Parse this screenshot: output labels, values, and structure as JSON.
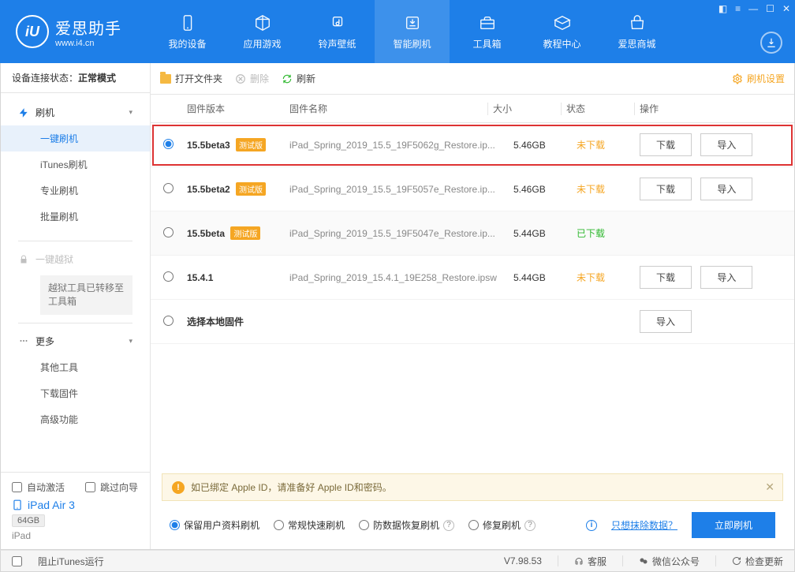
{
  "titlebar": {
    "controls": [
      "◧",
      "≡",
      "—",
      "☐",
      "✕"
    ]
  },
  "logo": {
    "name": "爱思助手",
    "url": "www.i4.cn",
    "mark": "iU"
  },
  "nav": [
    {
      "label": "我的设备",
      "icon": "device"
    },
    {
      "label": "应用游戏",
      "icon": "apps"
    },
    {
      "label": "铃声壁纸",
      "icon": "ringtone"
    },
    {
      "label": "智能刷机",
      "icon": "flash",
      "active": true
    },
    {
      "label": "工具箱",
      "icon": "toolbox"
    },
    {
      "label": "教程中心",
      "icon": "tutorial"
    },
    {
      "label": "爱思商城",
      "icon": "shop"
    }
  ],
  "sidebar": {
    "conn_label": "设备连接状态：",
    "conn_value": "正常模式",
    "flash": {
      "head": "刷机",
      "items": [
        "一键刷机",
        "iTunes刷机",
        "专业刷机",
        "批量刷机"
      ]
    },
    "jailbreak": {
      "head": "一键越狱",
      "note": "越狱工具已转移至工具箱"
    },
    "more": {
      "head": "更多",
      "items": [
        "其他工具",
        "下载固件",
        "高级功能"
      ]
    },
    "auto_activate": "自动激活",
    "skip_guide": "跳过向导",
    "device_name": "iPad Air 3",
    "storage": "64GB",
    "device_type": "iPad"
  },
  "toolbar": {
    "open_folder": "打开文件夹",
    "delete": "删除",
    "refresh": "刷新",
    "settings": "刷机设置"
  },
  "table": {
    "headers": {
      "version": "固件版本",
      "name": "固件名称",
      "size": "大小",
      "status": "状态",
      "action": "操作"
    },
    "download_btn": "下载",
    "import_btn": "导入",
    "local_firmware": "选择本地固件",
    "rows": [
      {
        "version": "15.5beta3",
        "beta": "测试版",
        "name": "iPad_Spring_2019_15.5_19F5062g_Restore.ip...",
        "size": "5.46GB",
        "status": "未下载",
        "status_cls": "un",
        "dl": true,
        "imp": true,
        "highlight": true,
        "selected": true
      },
      {
        "version": "15.5beta2",
        "beta": "测试版",
        "name": "iPad_Spring_2019_15.5_19F5057e_Restore.ip...",
        "size": "5.46GB",
        "status": "未下载",
        "status_cls": "un",
        "dl": true,
        "imp": true
      },
      {
        "version": "15.5beta",
        "beta": "测试版",
        "name": "iPad_Spring_2019_15.5_19F5047e_Restore.ip...",
        "size": "5.44GB",
        "status": "已下载",
        "status_cls": "done",
        "alt": true
      },
      {
        "version": "15.4.1",
        "name": "iPad_Spring_2019_15.4.1_19E258_Restore.ipsw",
        "size": "5.44GB",
        "status": "未下载",
        "status_cls": "un",
        "dl": true,
        "imp": true
      }
    ]
  },
  "tip": "如已绑定 Apple ID，请准备好 Apple ID和密码。",
  "modes": {
    "keep_data": "保留用户资料刷机",
    "normal": "常规快速刷机",
    "anti_loss": "防数据恢复刷机",
    "repair": "修复刷机",
    "erase_link": "只想抹除数据？",
    "flash_now": "立即刷机"
  },
  "statusbar": {
    "block_itunes": "阻止iTunes运行",
    "version": "V7.98.53",
    "support": "客服",
    "wechat": "微信公众号",
    "update": "检查更新"
  }
}
